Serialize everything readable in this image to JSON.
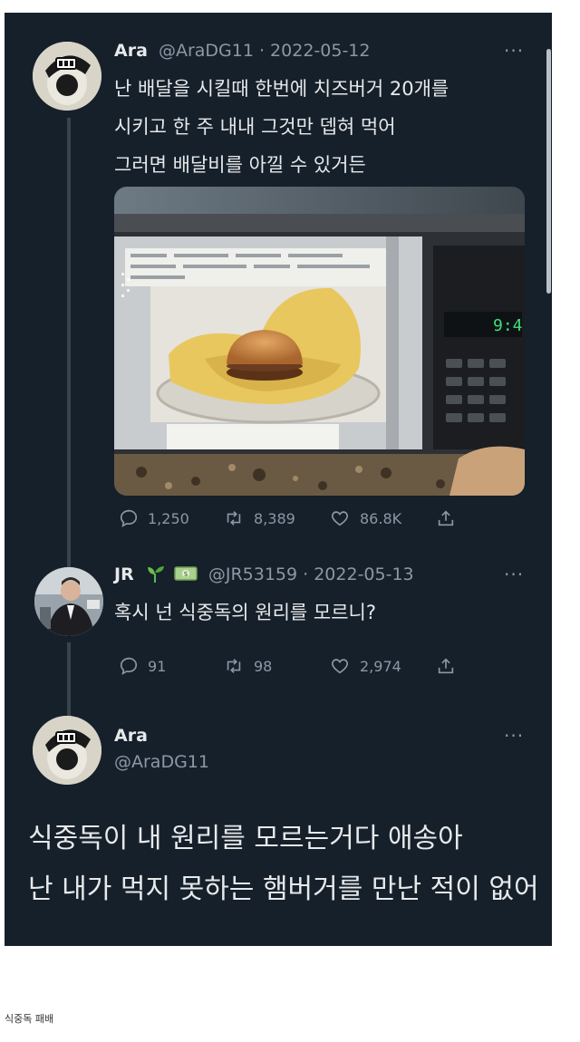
{
  "tweet1": {
    "name": "Ara",
    "handle_date": "@AraDG11 · 2022-05-12",
    "more": "···",
    "lines": [
      "난 배달을 시킬때 한번에 치즈버거 20개를",
      "시키고 한 주 내내 그것만 뎁혀 먹어",
      "그러면 배달비를 아낄 수 있거든"
    ],
    "microwave_clock": "9:4",
    "stats": {
      "replies": "1,250",
      "retweets": "8,389",
      "likes": "86.8K"
    }
  },
  "tweet2": {
    "name": "JR",
    "emoji": "🌱 💵",
    "handle_date": "@JR53159 · 2022-05-13",
    "more": "···",
    "text": "혹시 넌 식중독의 원리를 모르니?",
    "stats": {
      "replies": "91",
      "retweets": "98",
      "likes": "2,974"
    }
  },
  "tweet3": {
    "name": "Ara",
    "handle": "@AraDG11",
    "more": "···",
    "lines": [
      "식중독이 내 원리를 모르는거다 애송아",
      "난 내가 먹지 못하는 햄버거를 만난 적이 없어"
    ]
  },
  "caption": "식중독 패배",
  "icons": [
    "reply-icon",
    "retweet-icon",
    "like-icon",
    "share-icon",
    "more-icon",
    "sprout-emoji",
    "money-emoji"
  ],
  "colors": {
    "background": "#15202b",
    "text": "#e7e9ea",
    "muted": "#8b98a5",
    "thread": "#38444d"
  }
}
